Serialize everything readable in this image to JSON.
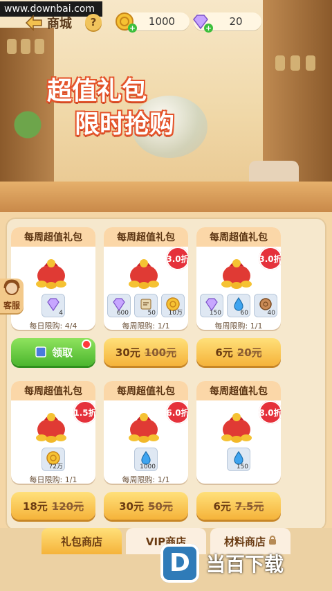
{
  "watermark": {
    "text": "www.downbai.com"
  },
  "header": {
    "title": "商城",
    "help_label": "?"
  },
  "currency": {
    "coins": "1000",
    "gems": "20",
    "plus": "+"
  },
  "headline": {
    "line1": "超值礼包",
    "line2": "限时抢购"
  },
  "side": {
    "service_label": "客服"
  },
  "cards": [
    {
      "title": "每周超值礼包",
      "discount": "",
      "items": [
        {
          "icon": "purple-gem-icon",
          "amount": "4"
        }
      ],
      "limit": "每日限购: 4/4",
      "button": {
        "type": "claim",
        "label": "领取"
      }
    },
    {
      "title": "每周超值礼包",
      "discount": "3.0折",
      "items": [
        {
          "icon": "purple-gem-icon",
          "amount": "600"
        },
        {
          "icon": "scroll-icon",
          "amount": "50"
        },
        {
          "icon": "gold-coin-icon",
          "amount": "10万"
        }
      ],
      "limit": "每周限购: 1/1",
      "button": {
        "type": "price",
        "now": "30元",
        "old": "100元"
      }
    },
    {
      "title": "每周超值礼包",
      "discount": "3.0折",
      "items": [
        {
          "icon": "purple-gem-icon",
          "amount": "150"
        },
        {
          "icon": "water-drop-icon",
          "amount": "60"
        },
        {
          "icon": "wood-log-icon",
          "amount": "40"
        }
      ],
      "limit": "每周限购: 1/1",
      "button": {
        "type": "price",
        "now": "6元",
        "old": "20元"
      }
    },
    {
      "title": "每周超值礼包",
      "discount": "1.5折",
      "items": [
        {
          "icon": "gold-coin-icon",
          "amount": "72万"
        }
      ],
      "limit": "每日限购: 1/1",
      "button": {
        "type": "price",
        "now": "18元",
        "old": "120元"
      }
    },
    {
      "title": "每周超值礼包",
      "discount": "6.0折",
      "items": [
        {
          "icon": "water-drop-icon",
          "amount": "1000"
        }
      ],
      "limit": "每周限购: 1/1",
      "button": {
        "type": "price",
        "now": "30元",
        "old": "50元"
      }
    },
    {
      "title": "每周超值礼包",
      "discount": "8.0折",
      "items": [
        {
          "icon": "water-drop-icon",
          "amount": "150"
        }
      ],
      "limit": "",
      "button": {
        "type": "price",
        "now": "6元",
        "old": "7.5元"
      }
    }
  ],
  "tabs": {
    "gift": "礼包商店",
    "vip": "VIP商店",
    "material": "材料商店"
  },
  "brand": {
    "letter": "D",
    "text": "当百下载"
  }
}
